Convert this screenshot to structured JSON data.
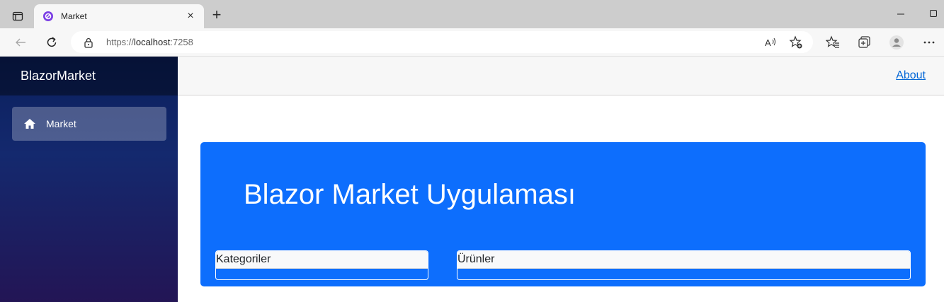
{
  "browser": {
    "tab_title": "Market",
    "url_prefix": "https://",
    "url_host": "localhost",
    "url_port": ":7258"
  },
  "app": {
    "brand": "BlazorMarket",
    "nav": [
      {
        "label": "Market",
        "icon": "home-icon",
        "active": true
      }
    ],
    "topbar": {
      "about_label": "About"
    },
    "main": {
      "heading": "Blazor Market Uygulaması",
      "cards": [
        {
          "header": "Kategoriler"
        },
        {
          "header": "Ürünler"
        }
      ]
    }
  },
  "colors": {
    "primary": "#0d6efd",
    "link": "#0366d6",
    "sidebar_top": "#0a1f5c",
    "sidebar_bottom": "#231555"
  }
}
